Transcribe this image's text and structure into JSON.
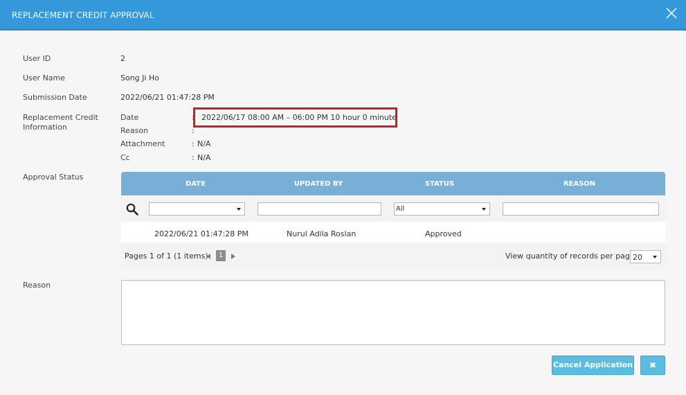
{
  "dialog": {
    "title": "REPLACEMENT CREDIT APPROVAL"
  },
  "fields": {
    "user_id_label": "User ID",
    "user_id_value": "2",
    "user_name_label": "User Name",
    "user_name_value": "Song Ji Ho",
    "submission_date_label": "Submission Date",
    "submission_date_value": "2022/06/21 01:47:28 PM",
    "replacement_label_line1": "Replacement Credit",
    "replacement_label_line2": "Information"
  },
  "replacement_info": {
    "date_label": "Date",
    "date_value": "2022/06/17 08:00 AM – 06:00 PM 10 hour 0 minute",
    "reason_label": "Reason",
    "reason_value": "",
    "attachment_label": "Attachment",
    "attachment_value": "N/A",
    "cc_label": "Cc",
    "cc_value": "N/A",
    "colon": ":"
  },
  "approval": {
    "label": "Approval Status",
    "columns": [
      "DATE",
      "UPDATED BY",
      "STATUS",
      "REASON"
    ],
    "filters": {
      "date_value": "",
      "updated_by_value": "",
      "status_value": "All",
      "reason_value": ""
    },
    "rows": [
      {
        "date": "2022/06/21 01:47:28 PM",
        "updated_by": "Nurul Adila Roslan",
        "status": "Approved",
        "reason": ""
      }
    ],
    "pager": {
      "summary": "Pages 1 of 1 (1 items)",
      "current_page": "1",
      "per_page_label": "View quantity of records per page",
      "per_page_value": "20"
    }
  },
  "reason_section": {
    "label": "Reason",
    "value": ""
  },
  "buttons": {
    "cancel_application": "Cancel Application",
    "close_symbol": "✖"
  },
  "colors": {
    "titlebar": "#3498db",
    "grid_header": "#77afd6",
    "button": "#58bde0",
    "highlight_border": "#e0141e"
  }
}
